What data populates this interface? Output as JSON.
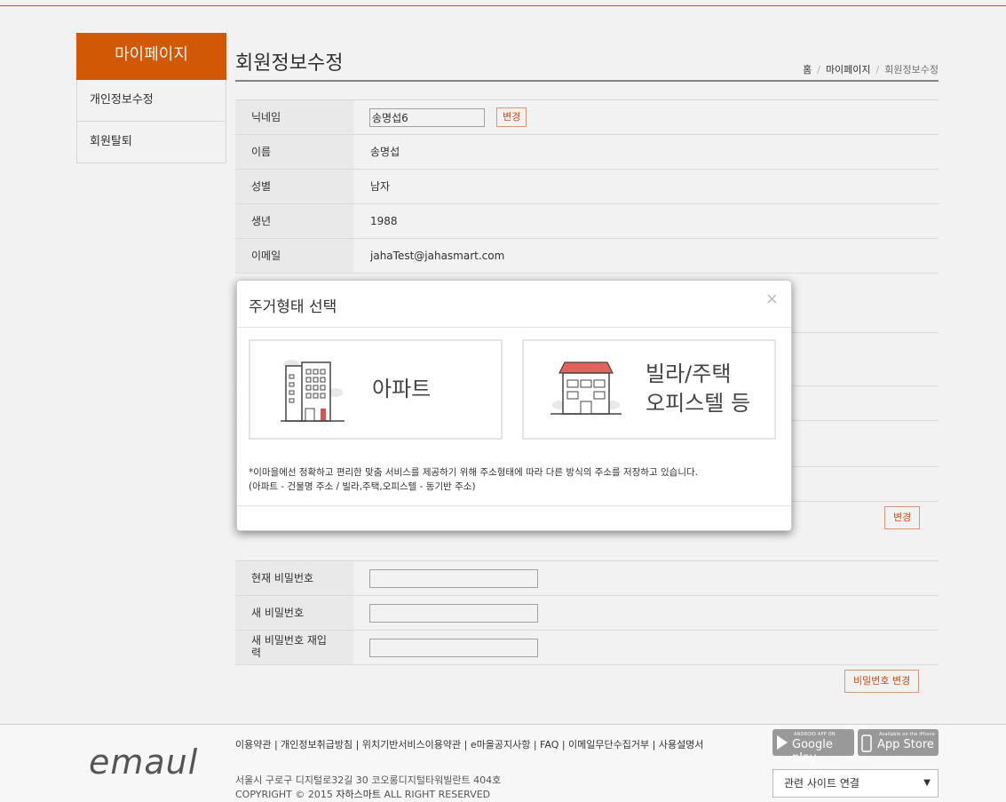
{
  "sidebar": {
    "title": "마이페이지",
    "items": [
      {
        "label": "개인정보수정"
      },
      {
        "label": "회원탈퇴"
      }
    ]
  },
  "header": {
    "title": "회원정보수정",
    "breadcrumb": {
      "home": "홈",
      "section": "마이페이지",
      "current": "회원정보수정",
      "separator": "/"
    }
  },
  "profile": {
    "nickname_label": "닉네임",
    "nickname_value": "송명섭6",
    "nickname_button": "변경",
    "name_label": "이름",
    "name_value": "송명섭",
    "gender_label": "성별",
    "gender_value": "남자",
    "birthyear_label": "생년",
    "birthyear_value": "1988",
    "email_label": "이메일",
    "email_value": "jahaTest@jahasmart.com",
    "address_button": "변경"
  },
  "password": {
    "current_label": "현재 비밀번호",
    "new_label": "새 비밀번호",
    "confirm_label": "새 비밀번호 재입력",
    "change_button": "비밀번호 변경"
  },
  "modal": {
    "title": "주거형태 선택",
    "close_glyph": "×",
    "options": [
      {
        "label": "아파트",
        "icon": "apartment-building-icon"
      },
      {
        "label_line1": "빌라/주택",
        "label_line2": "오피스텔 등",
        "icon": "villa-house-icon"
      }
    ],
    "note_line1": "*이마을에선 정확하고 편리한 맞춤 서비스를 제공하기 위해 주소형태에 따라 다른 방식의 주소를 저장하고 있습니다.",
    "note_line2": "(아파트 - 건물명 주소 / 빌라,주택,오피스텔 - 동기반 주소)"
  },
  "footer": {
    "logo": "emaul",
    "links": "이용약관 | 개인정보취급방침 | 위치기반서비스이용약관 | e마을공지사항 | FAQ | 이메일무단수집거부 | 사용설명서",
    "address": "서울시 구로구 디지털로32길 30 코오롱디지털타워빌란트 404호",
    "copyright_prefix": "COPYRIGHT © 2015 ",
    "copyright_company": "자하스마트",
    "copyright_suffix": " ALL RIGHT RESERVED",
    "google_play_small": "ANDROID APP ON",
    "google_play_big": "Google play",
    "app_store_small": "Available on the iPhone",
    "app_store_big": "App Store",
    "related_sites": "관련 사이트 연결",
    "select_arrow": "▼"
  },
  "colors": {
    "accent": "#dd5d06",
    "button_text": "#d2531b"
  }
}
